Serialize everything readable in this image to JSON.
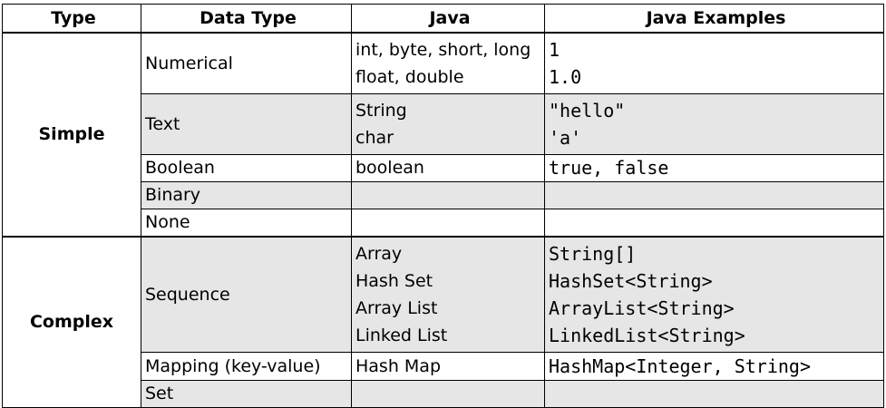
{
  "headers": [
    "Type",
    "Data Type",
    "Java",
    "Java Examples"
  ],
  "groups": {
    "simple": {
      "label": "Simple",
      "rows": {
        "numerical": {
          "data_type": "Numerical",
          "java": [
            "int, byte, short, long",
            "float, double"
          ],
          "examples": [
            "1",
            "1.0"
          ]
        },
        "text": {
          "data_type": "Text",
          "java": [
            "String",
            "char"
          ],
          "examples": [
            "\"hello\"",
            "'a'"
          ]
        },
        "boolean": {
          "data_type": "Boolean",
          "java": "boolean",
          "examples": "true, false"
        },
        "binary": {
          "data_type": "Binary",
          "java": "",
          "examples": ""
        },
        "none": {
          "data_type": "None",
          "java": "",
          "examples": ""
        }
      }
    },
    "complex": {
      "label": "Complex",
      "rows": {
        "sequence": {
          "data_type": "Sequence",
          "java": [
            "Array",
            "Hash Set",
            "Array List",
            "Linked List"
          ],
          "examples": [
            "String[]",
            "HashSet<String>",
            "ArrayList<String>",
            "LinkedList<String>"
          ]
        },
        "mapping": {
          "data_type": "Mapping (key-value)",
          "java": "Hash Map",
          "examples": "HashMap<Integer, String>"
        },
        "set": {
          "data_type": "Set",
          "java": "",
          "examples": ""
        }
      }
    }
  }
}
